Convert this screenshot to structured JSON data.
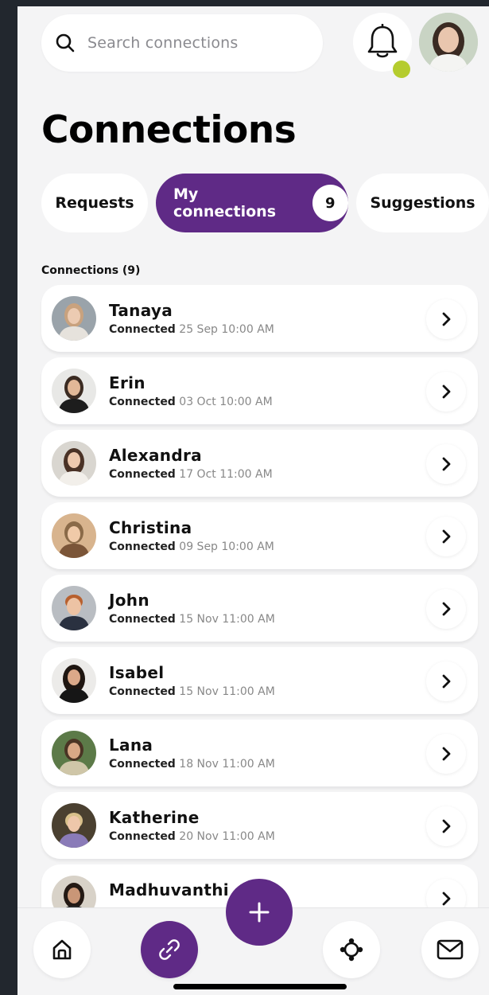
{
  "search": {
    "placeholder": "Search connections"
  },
  "header": {
    "title": "Connections"
  },
  "tabs": [
    {
      "label": "Requests"
    },
    {
      "label": "My connections",
      "badge": "9"
    },
    {
      "label": "Suggestions"
    }
  ],
  "section_label": "Connections (9)",
  "connections": [
    {
      "name": "Tanaya",
      "status": "Connected",
      "when": "25 Sep 10:00 AM"
    },
    {
      "name": "Erin",
      "status": "Connected",
      "when": "03 Oct 10:00 AM"
    },
    {
      "name": "Alexandra",
      "status": "Connected",
      "when": "17 Oct 11:00 AM"
    },
    {
      "name": "Christina",
      "status": "Connected",
      "when": "09 Sep 10:00 AM"
    },
    {
      "name": "John",
      "status": "Connected",
      "when": "15 Nov 11:00 AM"
    },
    {
      "name": "Isabel",
      "status": "Connected",
      "when": "15 Nov 11:00 AM"
    },
    {
      "name": "Lana",
      "status": "Connected",
      "when": "18 Nov 11:00 AM"
    },
    {
      "name": "Katherine",
      "status": "Connected",
      "when": "20 Nov 11:00 AM"
    },
    {
      "name": "Madhuvanthi",
      "status": "",
      "when": ""
    }
  ],
  "colors": {
    "accent": "#5f2a86",
    "notification_dot": "#b5cc2e",
    "background": "#f4f4f5"
  },
  "icons": {
    "search": "search-icon",
    "bell": "bell-icon",
    "chevron": "chevron-right-icon",
    "home": "home-icon",
    "link": "link-icon",
    "add": "plus-icon",
    "network": "network-icon",
    "mail": "mail-icon"
  }
}
